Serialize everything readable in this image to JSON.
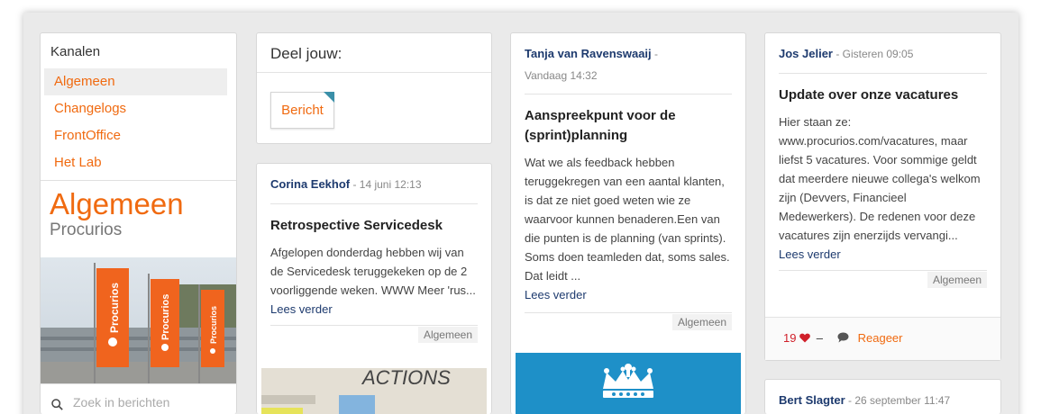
{
  "sidebar": {
    "title": "Kanalen",
    "items": [
      {
        "label": "Algemeen",
        "active": true
      },
      {
        "label": "Changelogs",
        "active": false
      },
      {
        "label": "FrontOffice",
        "active": false
      },
      {
        "label": "Het Lab",
        "active": false
      }
    ],
    "brand_title": "Algemeen",
    "brand_subtitle": "Procurios",
    "flag_text": "Procurios",
    "search_placeholder": "Zoek in berichten"
  },
  "share": {
    "title": "Deel jouw:",
    "button_label": "Bericht"
  },
  "posts": [
    {
      "author": "Corina Eekhof",
      "meta": " - 14 juni 12:13",
      "title": "Retrospective Servicedesk",
      "body": "Afgelopen donderdag hebben wij van de Servicedesk teruggekeken op de 2 voorliggende weken.  WWW  Meer 'rus...",
      "read_more": "Lees verder",
      "tag": "Algemeen",
      "image_text": "ACTIONS"
    },
    {
      "author": "Tanja van Ravenswaaij",
      "meta": " -",
      "meta2": "Vandaag 14:32",
      "title": "Aanspreekpunt voor de (sprint)planning",
      "body": "Wat we als feedback hebben teruggekregen van een aantal klanten, is dat ze niet goed weten wie ze waarvoor kunnen benaderen.Een van die punten is de planning (van sprints). Soms doen teamleden dat, soms sales. Dat leidt ...",
      "read_more": "Lees verder",
      "tag": "Algemeen"
    },
    {
      "author": "Jos Jelier",
      "meta": " - Gisteren 09:05",
      "title": "Update over onze vacatures",
      "body": "Hier staan ze: www.procurios.com/vacatures, maar liefst 5 vacatures. Voor sommige geldt dat meerdere nieuwe collega's welkom zijn (Devvers, Financieel Medewerkers). De redenen voor deze vacatures zijn enerzijds vervangi...",
      "read_more": "Lees verder",
      "tag": "Algemeen",
      "likes": "19",
      "dash": "–",
      "reply_label": "Reageer"
    },
    {
      "author": "Bert Slagter",
      "meta": " - 26 september 11:47"
    }
  ],
  "colors": {
    "accent": "#f06a10",
    "author": "#1d3a6e",
    "heart": "#d0202a",
    "banner_blue": "#1e90c8"
  }
}
